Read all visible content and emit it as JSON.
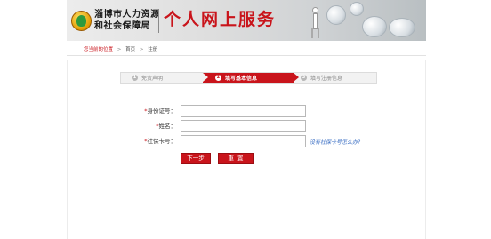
{
  "header": {
    "org_line1": "淄博市人力资源",
    "org_line2": "和社会保障局",
    "title": "个人网上服务"
  },
  "breadcrumb": {
    "current_label": "您当前的位置",
    "items": [
      "首页",
      "注册"
    ]
  },
  "steps": [
    {
      "num": "1",
      "label": "免责声明"
    },
    {
      "num": "2",
      "label": "填写基本信息"
    },
    {
      "num": "3",
      "label": "填写注册信息"
    }
  ],
  "form": {
    "id_label": "身份证号：",
    "id_value": "",
    "name_label": "姓名：",
    "name_value": "",
    "card_label": "社保卡号：",
    "card_value": "",
    "required_mark": "*",
    "help_link": "没有社保卡号怎么办?"
  },
  "buttons": {
    "next": "下一步",
    "reset": "重置"
  },
  "colors": {
    "accent": "#c9141b",
    "link": "#3b6fc4"
  }
}
